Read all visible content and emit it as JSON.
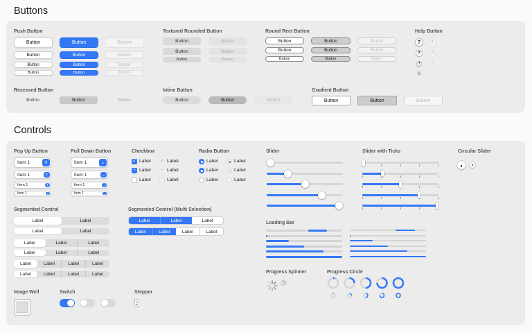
{
  "buttons_section": {
    "title": "Buttons",
    "push": {
      "title": "Push Button",
      "label": "Button"
    },
    "textured": {
      "title": "Textured Rounded Button",
      "label": "Button"
    },
    "roundrect": {
      "title": "Round Rect Button",
      "label": "Button"
    },
    "help": {
      "title": "Help Button",
      "glyph": "?"
    },
    "recessed": {
      "title": "Recessed Button",
      "label": "Button"
    },
    "inline": {
      "title": "Inline Button",
      "label": "Button"
    },
    "gradient": {
      "title": "Gradient Button",
      "label": "Button"
    }
  },
  "controls_section": {
    "title": "Controls",
    "popup": {
      "title": "Pop Up Button",
      "value": "Item 1"
    },
    "pulldown": {
      "title": "Pull Down Button",
      "value": "Item 1"
    },
    "checkbox": {
      "title": "Checkbox",
      "label": "Label"
    },
    "radio": {
      "title": "Radio Button",
      "label": "Label"
    },
    "slider": {
      "title": "Slider",
      "values": [
        0,
        0.25,
        0.5,
        0.75,
        1
      ]
    },
    "slider_ticks": {
      "title": "Slider with Ticks",
      "values": [
        0,
        0.25,
        0.5,
        0.75,
        1
      ]
    },
    "circular_slider": {
      "title": "Circular Slider"
    },
    "segmented": {
      "title": "Segmented Control",
      "label": "Label"
    },
    "segmented_multi": {
      "title": "Segmented Control (Multi Selection)",
      "label": "Label"
    },
    "loading": {
      "title": "Loading Bar"
    },
    "spinner": {
      "title": "Progress Spinner"
    },
    "progress_circle": {
      "title": "Progress Circle",
      "values": [
        0.05,
        0.25,
        0.5,
        0.75,
        1
      ]
    },
    "image_well": {
      "title": "Image Well"
    },
    "switch": {
      "title": "Switch"
    },
    "stepper": {
      "title": "Stepper"
    }
  },
  "colors": {
    "accent": "#3478f6",
    "panel": "#ececec",
    "background": "#fafafa"
  },
  "icons": [
    "chevron-updown-icon",
    "chevron-down-icon",
    "checkmark-icon",
    "dash-icon",
    "spinner-icon"
  ]
}
